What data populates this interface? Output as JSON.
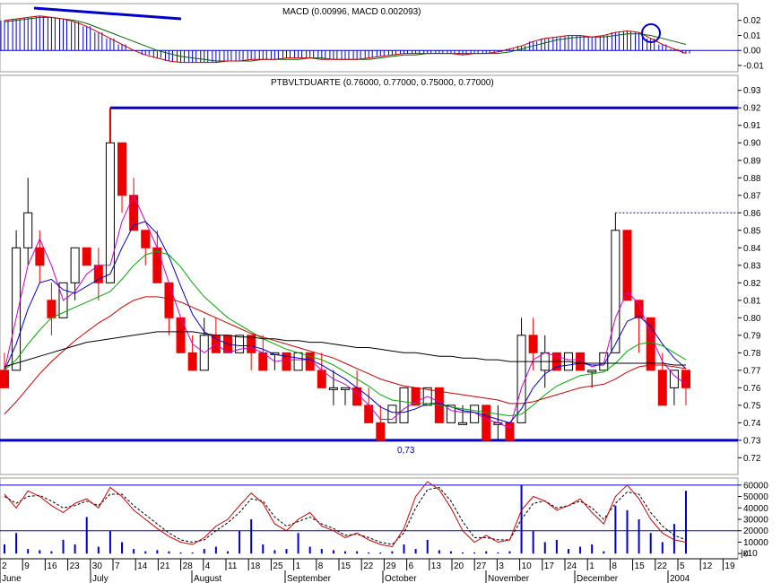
{
  "chart_data": [
    {
      "type": "line",
      "panel": "macd",
      "title": "MACD (0.00996, MACD 0.002093)",
      "y_ticks": [
        "0.02",
        "0.01",
        "0.00",
        "-0.01"
      ],
      "ylim": [
        -0.013,
        0.03
      ],
      "series": [
        {
          "name": "MACD",
          "color": "#cc0000",
          "values": [
            0.02,
            0.021,
            0.022,
            0.023,
            0.022,
            0.021,
            0.019,
            0.016,
            0.012,
            0.008,
            0.004,
            0.0,
            -0.003,
            -0.005,
            -0.007,
            -0.008,
            -0.008,
            -0.008,
            -0.008,
            -0.007,
            -0.007,
            -0.006,
            -0.006,
            -0.006,
            -0.005,
            -0.005,
            -0.005,
            -0.006,
            -0.006,
            -0.006,
            -0.006,
            -0.005,
            -0.004,
            -0.003,
            -0.002,
            -0.002,
            -0.002,
            -0.002,
            -0.002,
            -0.003,
            -0.002,
            -0.002,
            -0.001,
            0.001,
            0.003,
            0.006,
            0.008,
            0.009,
            0.01,
            0.01,
            0.009,
            0.01,
            0.012,
            0.013,
            0.012,
            0.008,
            0.004,
            0.001,
            -0.002
          ]
        },
        {
          "name": "Signal",
          "color": "#006600",
          "values": [
            0.019,
            0.02,
            0.021,
            0.022,
            0.022,
            0.021,
            0.02,
            0.018,
            0.015,
            0.012,
            0.009,
            0.006,
            0.003,
            0.0,
            -0.002,
            -0.004,
            -0.005,
            -0.006,
            -0.007,
            -0.007,
            -0.007,
            -0.007,
            -0.006,
            -0.006,
            -0.006,
            -0.006,
            -0.005,
            -0.005,
            -0.006,
            -0.006,
            -0.006,
            -0.006,
            -0.005,
            -0.004,
            -0.003,
            -0.003,
            -0.002,
            -0.002,
            -0.002,
            -0.002,
            -0.002,
            -0.002,
            -0.002,
            -0.001,
            0.001,
            0.003,
            0.005,
            0.007,
            0.008,
            0.009,
            0.009,
            0.009,
            0.01,
            0.011,
            0.011,
            0.01,
            0.008,
            0.006,
            0.004
          ]
        }
      ]
    },
    {
      "type": "candlestick",
      "panel": "price",
      "title": "PTBVLTDUARTE (0.76000, 0.77000, 0.75000, 0.77000)",
      "y_ticks": [
        "0.93",
        "0.92",
        "0.91",
        "0.90",
        "0.89",
        "0.88",
        "0.87",
        "0.86",
        "0.85",
        "0.84",
        "0.83",
        "0.82",
        "0.81",
        "0.80",
        "0.79",
        "0.78",
        "0.77",
        "0.76",
        "0.75",
        "0.74",
        "0.73",
        "0.72"
      ],
      "ylim": [
        0.7125,
        0.9355
      ],
      "support_label": "0,73",
      "resistance": 0.92,
      "support": 0.73,
      "dotted_level": 0.86,
      "x_ticks": [
        "2",
        "9",
        "16",
        "23",
        "30",
        "7",
        "14",
        "21",
        "28",
        "4",
        "11",
        "18",
        "25",
        "1",
        "8",
        "15",
        "22",
        "29",
        "6",
        "13",
        "20",
        "27",
        "3",
        "10",
        "17",
        "24",
        "1",
        "8",
        "15",
        "22",
        "5",
        "12",
        "19"
      ],
      "month_labels": [
        "June",
        "July",
        "August",
        "September",
        "October",
        "November",
        "December",
        "2004"
      ],
      "ohlc": [
        [
          0.77,
          0.78,
          0.76,
          0.76
        ],
        [
          0.77,
          0.85,
          0.77,
          0.84
        ],
        [
          0.84,
          0.88,
          0.83,
          0.86
        ],
        [
          0.84,
          0.85,
          0.82,
          0.83
        ],
        [
          0.81,
          0.82,
          0.79,
          0.8
        ],
        [
          0.8,
          0.82,
          0.8,
          0.82
        ],
        [
          0.82,
          0.84,
          0.81,
          0.84
        ],
        [
          0.84,
          0.84,
          0.83,
          0.83
        ],
        [
          0.83,
          0.84,
          0.81,
          0.82
        ],
        [
          0.82,
          0.9,
          0.82,
          0.9
        ],
        [
          0.9,
          0.9,
          0.86,
          0.87
        ],
        [
          0.87,
          0.88,
          0.85,
          0.85
        ],
        [
          0.85,
          0.85,
          0.83,
          0.84
        ],
        [
          0.84,
          0.85,
          0.82,
          0.82
        ],
        [
          0.82,
          0.82,
          0.79,
          0.8
        ],
        [
          0.8,
          0.8,
          0.78,
          0.78
        ],
        [
          0.78,
          0.79,
          0.77,
          0.77
        ],
        [
          0.77,
          0.8,
          0.77,
          0.79
        ],
        [
          0.79,
          0.8,
          0.78,
          0.78
        ],
        [
          0.79,
          0.79,
          0.78,
          0.78
        ],
        [
          0.78,
          0.79,
          0.78,
          0.79
        ],
        [
          0.79,
          0.79,
          0.77,
          0.78
        ],
        [
          0.78,
          0.79,
          0.77,
          0.77
        ],
        [
          0.78,
          0.78,
          0.77,
          0.78
        ],
        [
          0.78,
          0.78,
          0.77,
          0.77
        ],
        [
          0.77,
          0.78,
          0.77,
          0.78
        ],
        [
          0.78,
          0.78,
          0.77,
          0.77
        ],
        [
          0.77,
          0.78,
          0.76,
          0.76
        ],
        [
          0.76,
          0.77,
          0.75,
          0.76
        ],
        [
          0.76,
          0.76,
          0.75,
          0.76
        ],
        [
          0.76,
          0.77,
          0.75,
          0.75
        ],
        [
          0.75,
          0.76,
          0.74,
          0.74
        ],
        [
          0.74,
          0.75,
          0.73,
          0.73
        ],
        [
          0.74,
          0.75,
          0.74,
          0.75
        ],
        [
          0.74,
          0.76,
          0.74,
          0.76
        ],
        [
          0.76,
          0.76,
          0.75,
          0.75
        ],
        [
          0.75,
          0.76,
          0.75,
          0.76
        ],
        [
          0.76,
          0.76,
          0.74,
          0.74
        ],
        [
          0.74,
          0.75,
          0.74,
          0.75
        ],
        [
          0.74,
          0.75,
          0.74,
          0.74
        ],
        [
          0.74,
          0.75,
          0.74,
          0.75
        ],
        [
          0.75,
          0.75,
          0.73,
          0.73
        ],
        [
          0.74,
          0.75,
          0.73,
          0.74
        ],
        [
          0.74,
          0.74,
          0.73,
          0.73
        ],
        [
          0.74,
          0.8,
          0.74,
          0.79
        ],
        [
          0.79,
          0.8,
          0.77,
          0.78
        ],
        [
          0.77,
          0.79,
          0.76,
          0.78
        ],
        [
          0.78,
          0.78,
          0.77,
          0.77
        ],
        [
          0.77,
          0.78,
          0.77,
          0.78
        ],
        [
          0.78,
          0.78,
          0.77,
          0.77
        ],
        [
          0.77,
          0.77,
          0.76,
          0.77
        ],
        [
          0.77,
          0.78,
          0.77,
          0.78
        ],
        [
          0.78,
          0.86,
          0.78,
          0.85
        ],
        [
          0.85,
          0.85,
          0.81,
          0.81
        ],
        [
          0.81,
          0.81,
          0.78,
          0.8
        ],
        [
          0.8,
          0.8,
          0.77,
          0.77
        ],
        [
          0.77,
          0.78,
          0.75,
          0.75
        ],
        [
          0.76,
          0.77,
          0.75,
          0.77
        ],
        [
          0.77,
          0.77,
          0.75,
          0.76
        ]
      ],
      "series": [
        {
          "name": "MA short",
          "color": "#cc00cc",
          "values": [
            0.77,
            0.8,
            0.83,
            0.845,
            0.83,
            0.81,
            0.815,
            0.825,
            0.83,
            0.83,
            0.855,
            0.87,
            0.855,
            0.84,
            0.82,
            0.8,
            0.785,
            0.78,
            0.785,
            0.78,
            0.782,
            0.783,
            0.78,
            0.775,
            0.776,
            0.776,
            0.776,
            0.77,
            0.765,
            0.762,
            0.757,
            0.75,
            0.742,
            0.742,
            0.748,
            0.752,
            0.755,
            0.752,
            0.747,
            0.746,
            0.746,
            0.742,
            0.74,
            0.737,
            0.76,
            0.776,
            0.78,
            0.778,
            0.776,
            0.776,
            0.772,
            0.774,
            0.8,
            0.815,
            0.808,
            0.79,
            0.775,
            0.767,
            0.762
          ]
        },
        {
          "name": "MA medium",
          "color": "#0000cc",
          "values": [
            0.77,
            0.785,
            0.805,
            0.82,
            0.822,
            0.816,
            0.814,
            0.818,
            0.822,
            0.825,
            0.84,
            0.853,
            0.855,
            0.848,
            0.835,
            0.818,
            0.802,
            0.792,
            0.788,
            0.785,
            0.784,
            0.784,
            0.782,
            0.779,
            0.778,
            0.777,
            0.776,
            0.773,
            0.769,
            0.765,
            0.76,
            0.755,
            0.749,
            0.746,
            0.746,
            0.748,
            0.751,
            0.751,
            0.749,
            0.747,
            0.746,
            0.744,
            0.742,
            0.74,
            0.748,
            0.76,
            0.768,
            0.772,
            0.773,
            0.774,
            0.773,
            0.773,
            0.785,
            0.798,
            0.801,
            0.795,
            0.785,
            0.777,
            0.771
          ]
        },
        {
          "name": "MA long",
          "color": "#00aa00",
          "values": [
            0.77,
            0.776,
            0.785,
            0.793,
            0.8,
            0.803,
            0.806,
            0.809,
            0.812,
            0.815,
            0.822,
            0.83,
            0.836,
            0.838,
            0.836,
            0.829,
            0.82,
            0.812,
            0.806,
            0.8,
            0.796,
            0.792,
            0.788,
            0.785,
            0.782,
            0.78,
            0.778,
            0.776,
            0.773,
            0.769,
            0.765,
            0.761,
            0.756,
            0.753,
            0.752,
            0.751,
            0.751,
            0.75,
            0.749,
            0.748,
            0.747,
            0.746,
            0.745,
            0.744,
            0.745,
            0.75,
            0.756,
            0.761,
            0.764,
            0.767,
            0.768,
            0.769,
            0.774,
            0.781,
            0.785,
            0.786,
            0.784,
            0.78,
            0.776
          ]
        },
        {
          "name": "MA 50",
          "color": "#cc0000",
          "values": [
            0.745,
            0.752,
            0.76,
            0.768,
            0.775,
            0.781,
            0.787,
            0.792,
            0.797,
            0.801,
            0.806,
            0.81,
            0.812,
            0.812,
            0.811,
            0.809,
            0.806,
            0.803,
            0.8,
            0.797,
            0.794,
            0.791,
            0.789,
            0.787,
            0.785,
            0.783,
            0.781,
            0.779,
            0.777,
            0.774,
            0.771,
            0.768,
            0.765,
            0.763,
            0.761,
            0.76,
            0.759,
            0.758,
            0.757,
            0.756,
            0.755,
            0.754,
            0.753,
            0.751,
            0.751,
            0.752,
            0.754,
            0.756,
            0.758,
            0.76,
            0.761,
            0.762,
            0.765,
            0.769,
            0.772,
            0.773,
            0.773,
            0.772,
            0.771
          ]
        },
        {
          "name": "MA 200",
          "color": "#000000",
          "values": [
            0.772,
            0.774,
            0.776,
            0.778,
            0.78,
            0.782,
            0.784,
            0.786,
            0.787,
            0.788,
            0.789,
            0.79,
            0.791,
            0.792,
            0.792,
            0.792,
            0.792,
            0.791,
            0.79,
            0.79,
            0.789,
            0.789,
            0.788,
            0.788,
            0.787,
            0.787,
            0.786,
            0.786,
            0.785,
            0.784,
            0.783,
            0.783,
            0.782,
            0.781,
            0.78,
            0.78,
            0.779,
            0.778,
            0.778,
            0.777,
            0.777,
            0.776,
            0.776,
            0.775,
            0.775,
            0.775,
            0.775,
            0.775,
            0.775,
            0.774,
            0.774,
            0.774,
            0.774,
            0.774,
            0.774,
            0.774,
            0.774,
            0.773,
            0.773
          ]
        }
      ]
    },
    {
      "type": "line",
      "panel": "volume",
      "y_ticks": [
        "60000",
        "50000",
        "40000",
        "30000",
        "20000",
        "10000",
        "0"
      ],
      "y_unit": "x10",
      "ylim": [
        -3000,
        63000
      ],
      "series": [
        {
          "name": "Oscillator",
          "color": "#cc0000",
          "values": [
            52000,
            40000,
            55000,
            50000,
            42000,
            36000,
            44000,
            48000,
            40000,
            58000,
            50000,
            38000,
            30000,
            22000,
            15000,
            10000,
            8000,
            14000,
            24000,
            30000,
            42000,
            53000,
            44000,
            26000,
            20000,
            30000,
            36000,
            24000,
            20000,
            14000,
            18000,
            12000,
            8000,
            6000,
            22000,
            50000,
            63000,
            56000,
            40000,
            20000,
            10000,
            16000,
            10000,
            12000,
            38000,
            50000,
            46000,
            38000,
            42000,
            48000,
            36000,
            26000,
            50000,
            60000,
            48000,
            30000,
            18000,
            12000,
            10000
          ]
        },
        {
          "name": "Signal",
          "color": "#000000",
          "values": [
            50000,
            44000,
            50000,
            51000,
            46000,
            40000,
            42000,
            46000,
            42000,
            52000,
            52000,
            42000,
            34000,
            26000,
            18000,
            12000,
            10000,
            12000,
            20000,
            27000,
            36000,
            48000,
            46000,
            32000,
            24000,
            28000,
            32000,
            26000,
            22000,
            16000,
            17000,
            14000,
            10000,
            8000,
            18000,
            40000,
            56000,
            58000,
            46000,
            28000,
            14000,
            14000,
            12000,
            12000,
            30000,
            44000,
            46000,
            40000,
            42000,
            46000,
            40000,
            30000,
            44000,
            54000,
            52000,
            36000,
            24000,
            16000,
            12000
          ]
        },
        {
          "name": "Volume",
          "color": "#0000cc",
          "values": [
            8000,
            18000,
            4000,
            3000,
            2000,
            12000,
            8000,
            32000,
            6000,
            20000,
            10000,
            4000,
            2000,
            3000,
            2000,
            1000,
            1000,
            4000,
            6000,
            2000,
            20000,
            30000,
            8000,
            3000,
            4000,
            18000,
            6000,
            4000,
            3000,
            2000,
            2000,
            1000,
            1000,
            2000,
            8000,
            4000,
            12000,
            3000,
            2000,
            1000,
            1000,
            2000,
            1000,
            2000,
            60000,
            20000,
            10000,
            12000,
            4000,
            6000,
            8000,
            2000,
            42000,
            38000,
            30000,
            18000,
            10000,
            26000,
            55000
          ]
        }
      ]
    }
  ]
}
